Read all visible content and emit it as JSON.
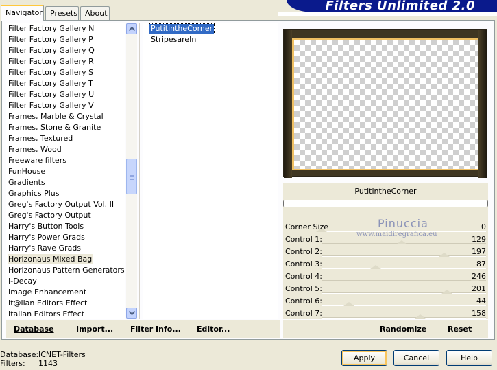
{
  "app": {
    "banner_title": "Filters Unlimited 2.0"
  },
  "tabs": [
    {
      "label": "Navigator",
      "active": true
    },
    {
      "label": "Presets",
      "active": false
    },
    {
      "label": "About",
      "active": false
    }
  ],
  "categories": {
    "items": [
      "Filter Factory Gallery N",
      "Filter Factory Gallery P",
      "Filter Factory Gallery Q",
      "Filter Factory Gallery R",
      "Filter Factory Gallery S",
      "Filter Factory Gallery T",
      "Filter Factory Gallery U",
      "Filter Factory Gallery V",
      "Frames, Marble & Crystal",
      "Frames, Stone & Granite",
      "Frames, Textured",
      "Frames, Wood",
      "Freeware filters",
      "FunHouse",
      "Gradients",
      "Graphics Plus",
      "Greg's Factory Output Vol. II",
      "Greg's Factory Output",
      "Harry's Button Tools",
      "Harry's Power Grads",
      "Harry's Rave Grads",
      "Horizonaus Mixed Bag",
      "Horizonaus Pattern Generators",
      "I-Decay",
      "Image Enhancement",
      "It@lian Editors Effect",
      "Italian Editors Effect"
    ],
    "selected_index": 21
  },
  "filters": {
    "items": [
      "PutitintheCorner",
      "StripesareIn"
    ],
    "selected_index": 0
  },
  "left_buttons": {
    "database": "Database",
    "import": "Import...",
    "filter_info": "Filter Info...",
    "editor": "Editor..."
  },
  "preview": {
    "filter_name": "PutitintheCorner",
    "frame_color": "#f0c063",
    "background_color": "#3f3622"
  },
  "watermark": {
    "name": "Pinuccia",
    "url": "www.maidiregrafica.eu"
  },
  "controls": [
    {
      "label": "Corner Size",
      "value": "0",
      "level": 0
    },
    {
      "label": "Control 1:",
      "value": "129",
      "level": 129
    },
    {
      "label": "Control 2:",
      "value": "197",
      "level": 197
    },
    {
      "label": "Control 3:",
      "value": "87",
      "level": 87
    },
    {
      "label": "Control 4:",
      "value": "246",
      "level": 246
    },
    {
      "label": "Control 5:",
      "value": "201",
      "level": 201
    },
    {
      "label": "Control 6:",
      "value": "44",
      "level": 44
    },
    {
      "label": "Control 7:",
      "value": "158",
      "level": 158
    }
  ],
  "right_buttons": {
    "randomize": "Randomize",
    "reset": "Reset"
  },
  "status": {
    "database_label": "Database:",
    "database_value": "ICNET-Filters",
    "filters_label": "Filters:",
    "filters_value": "1143"
  },
  "dialog_buttons": {
    "apply": "Apply",
    "cancel": "Cancel",
    "help": "Help"
  }
}
